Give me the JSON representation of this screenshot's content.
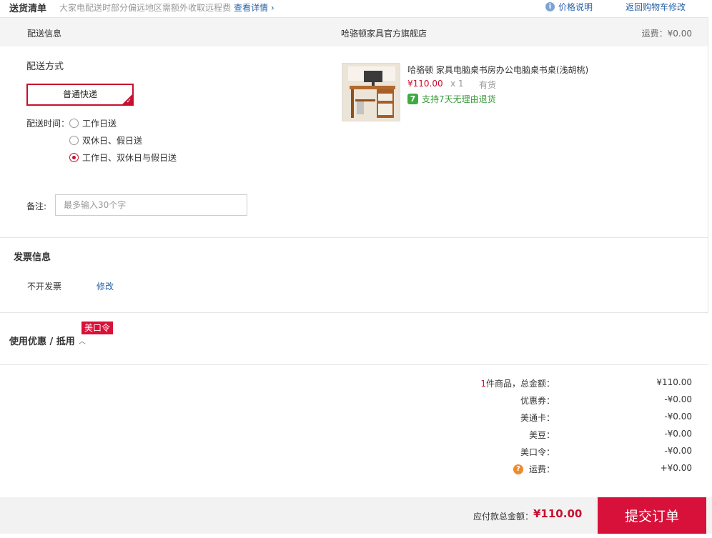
{
  "top": {
    "title": "送货清单",
    "notice": "大家电配送时部分偏远地区需额外收取远程费",
    "notice_link": "查看详情",
    "price_explain": "价格说明",
    "back_to_cart": "返回购物车修改"
  },
  "shipping_header": {
    "label": "配送信息",
    "store": "哈骆顿家具官方旗舰店",
    "freight": "运费：¥0.00"
  },
  "delivery": {
    "method_label": "配送方式",
    "method_selected": "普通快递",
    "time_label": "配送时间：",
    "time_options": [
      {
        "label": "工作日送",
        "selected": false
      },
      {
        "label": "双休日、假日送",
        "selected": false
      },
      {
        "label": "工作日、双休日与假日送",
        "selected": true
      }
    ],
    "remark_label": "备注:",
    "remark_placeholder": "最多输入30个字",
    "remark_value": ""
  },
  "product": {
    "name": "哈骆顿 家具电脑桌书房办公电脑桌书桌(浅胡桃)",
    "price": "¥110.00",
    "qty": "x 1",
    "stock": "有货",
    "return_badge": "7",
    "return_policy": "支持7天无理由退货"
  },
  "invoice": {
    "title": "发票信息",
    "value": "不开发票",
    "edit": "修改"
  },
  "coupon": {
    "title": "使用优惠 / 抵用",
    "badge": "美口令"
  },
  "summary": {
    "count": "1",
    "total_label": "件商品，总金额：",
    "total_value": "¥110.00",
    "rows": [
      {
        "label": "优惠券：",
        "value": "-¥0.00"
      },
      {
        "label": "美通卡：",
        "value": "-¥0.00"
      },
      {
        "label": "美豆：",
        "value": "-¥0.00"
      },
      {
        "label": "美口令：",
        "value": "-¥0.00"
      }
    ],
    "freight_label": "运费：",
    "freight_value": "+¥0.00"
  },
  "footer": {
    "payable_label": "应付款总金额：",
    "payable_value": "¥110.00",
    "submit": "提交订单"
  },
  "colors": {
    "accent_red": "#d8113a",
    "link_blue": "#2a63a8",
    "success_green": "#3dab3d",
    "help_orange": "#f08a2c"
  }
}
